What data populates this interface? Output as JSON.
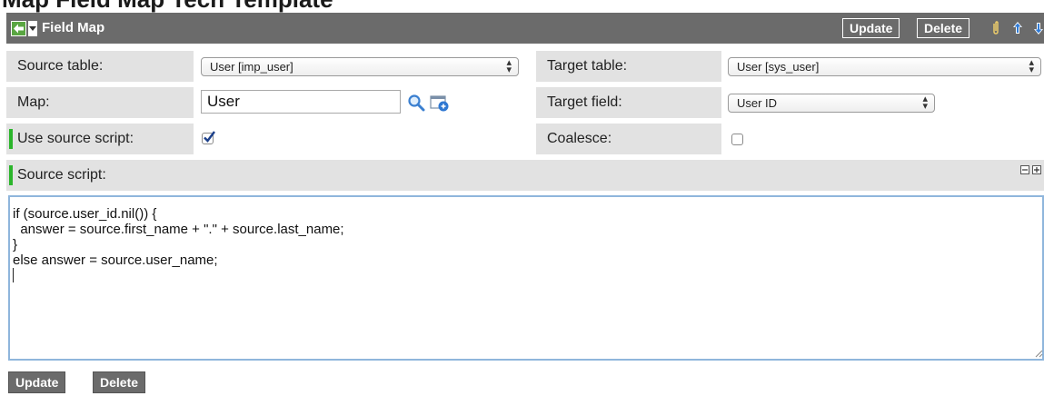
{
  "page_heading": "Map Field Map Tech Template",
  "header": {
    "title": "Field Map",
    "update_label": "Update",
    "delete_label": "Delete"
  },
  "form": {
    "source_table": {
      "label": "Source table:",
      "value": "User [imp_user]"
    },
    "target_table": {
      "label": "Target table:",
      "value": "User [sys_user]"
    },
    "map": {
      "label": "Map:",
      "value": "User"
    },
    "target_field": {
      "label": "Target field:",
      "value": "User ID"
    },
    "use_source_script": {
      "label": "Use source script:",
      "checked": true
    },
    "coalesce": {
      "label": "Coalesce:",
      "checked": false
    },
    "source_script": {
      "label": "Source script:",
      "code": "if (source.user_id.nil()) {\n  answer = source.first_name + \".\" + source.last_name;\n}\nelse answer = source.user_name;\n"
    }
  },
  "footer": {
    "update_label": "Update",
    "delete_label": "Delete"
  },
  "icons": {
    "back": "back-arrow-icon",
    "menu": "context-menu-icon",
    "attachment": "paperclip-icon",
    "up": "arrow-up-icon",
    "down": "arrow-down-icon",
    "lookup": "magnifier-icon",
    "reference": "reference-info-icon",
    "collapse": "minus-box-icon",
    "expand": "plus-box-icon"
  },
  "colors": {
    "header_bg": "#6b6b6b",
    "label_bg": "#e2e2e2",
    "required_marker": "#2bb52b",
    "back_button": "#5aa642",
    "nav_arrows": "#2f7bd6",
    "script_border": "#8fb6dc"
  }
}
